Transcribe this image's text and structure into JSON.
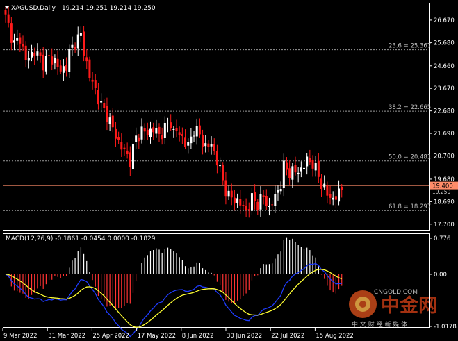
{
  "header": {
    "symbol": "XAGUSD,Daily",
    "ohlc": "19.214 19.251 19.214 19.250"
  },
  "macd_label": "MACD(12,26,9) -0.1861 -0.0454 0.0000 -0.1829",
  "price_ticks": [
    "26.670",
    "25.680",
    "24.660",
    "23.670",
    "22.680",
    "21.690",
    "20.700",
    "19.680",
    "18.690",
    "17.700"
  ],
  "price_axis_values": [
    26.67,
    25.68,
    24.66,
    23.67,
    22.68,
    21.69,
    20.7,
    19.68,
    18.69,
    17.7
  ],
  "price_range": [
    17.45,
    27.4
  ],
  "current_price": "19.400",
  "current_price_value": 19.4,
  "bid_label": "19.250",
  "fib_levels": [
    {
      "label": "23.6 = 25.367",
      "value": 25.367
    },
    {
      "label": "38.2 = 22.665",
      "value": 22.665
    },
    {
      "label": "50.0 = 20.481",
      "value": 20.481
    },
    {
      "label": "61.8 = 18.297",
      "value": 18.297
    }
  ],
  "macd_ticks": [
    "0.776",
    "0.00",
    "-1.0178"
  ],
  "macd_axis_values": [
    0.776,
    0.0,
    -1.0178
  ],
  "date_labels": [
    "9 Mar 2022",
    "31 Mar 2022",
    "25 Apr 2022",
    "17 May 2022",
    "8 Jun 2022",
    "30 Jun 2022",
    "22 Jul 2022",
    "15 Aug 2022"
  ],
  "watermark": {
    "cn_big": "中金网",
    "cn_small": "中 文 财 经 新 媒 体",
    "en": "CNGOLD.COM"
  },
  "colors": {
    "bull": "#ffffff",
    "bear": "#ff1a1a",
    "hist_pos": "#ffffff",
    "hist_neg": "#ff3333",
    "macd": "#1f3cff",
    "signal": "#ffff33",
    "current": "#ff8c69",
    "fib": "#9a9a9a"
  },
  "chart_data": {
    "type": "candlestick",
    "symbol": "XAGUSD",
    "timeframe": "Daily",
    "x_labels": [
      "9 Mar 2022",
      "31 Mar 2022",
      "25 Apr 2022",
      "17 May 2022",
      "8 Jun 2022",
      "30 Jun 2022",
      "22 Jul 2022",
      "15 Aug 2022"
    ],
    "ylim": [
      17.45,
      27.4
    ],
    "price_path": [
      [
        0,
        26.8
      ],
      [
        3,
        25.6
      ],
      [
        5,
        25.9
      ],
      [
        7,
        24.9
      ],
      [
        10,
        25.3
      ],
      [
        13,
        24.8
      ],
      [
        15,
        25.0
      ],
      [
        17,
        24.9
      ],
      [
        19,
        24.4
      ],
      [
        21,
        24.7
      ],
      [
        22,
        25.2
      ],
      [
        24,
        25.7
      ],
      [
        26,
        26.0
      ],
      [
        27,
        25.3
      ],
      [
        29,
        24.2
      ],
      [
        31,
        23.6
      ],
      [
        33,
        22.9
      ],
      [
        35,
        22.5
      ],
      [
        37,
        21.9
      ],
      [
        39,
        21.3
      ],
      [
        41,
        20.9
      ],
      [
        43,
        20.5
      ],
      [
        45,
        21.5
      ],
      [
        47,
        21.8
      ],
      [
        49,
        21.7
      ],
      [
        51,
        21.9
      ],
      [
        53,
        21.6
      ],
      [
        55,
        21.9
      ],
      [
        57,
        22.2
      ],
      [
        58,
        21.7
      ],
      [
        59,
        21.8
      ],
      [
        61,
        21.5
      ],
      [
        63,
        21.1
      ],
      [
        65,
        21.9
      ],
      [
        67,
        21.6
      ],
      [
        69,
        21.1
      ],
      [
        71,
        21.2
      ],
      [
        73,
        20.5
      ],
      [
        75,
        19.6
      ],
      [
        77,
        18.9
      ],
      [
        79,
        18.8
      ],
      [
        81,
        18.6
      ],
      [
        83,
        18.3
      ],
      [
        85,
        18.8
      ],
      [
        87,
        18.6
      ],
      [
        89,
        18.9
      ],
      [
        91,
        18.4
      ],
      [
        93,
        18.9
      ],
      [
        95,
        19.5
      ],
      [
        96,
        20.2
      ],
      [
        98,
        20.0
      ],
      [
        100,
        20.0
      ],
      [
        102,
        20.1
      ],
      [
        104,
        20.5
      ],
      [
        106,
        20.4
      ],
      [
        107,
        20.1
      ],
      [
        109,
        19.5
      ],
      [
        111,
        19.0
      ],
      [
        113,
        18.8
      ],
      [
        115,
        19.05
      ],
      [
        116,
        19.25
      ]
    ],
    "series": [
      {
        "name": "MACD(12,26,9)",
        "last": -0.1861
      },
      {
        "name": "Signal",
        "last": -0.0454
      },
      {
        "name": "Histogram",
        "last": -0.1829
      }
    ],
    "macd_range": [
      -1.0178,
      0.776
    ],
    "fib_retracements": [
      {
        "level": "23.6",
        "value": 25.367
      },
      {
        "level": "38.2",
        "value": 22.665
      },
      {
        "level": "50.0",
        "value": 20.481
      },
      {
        "level": "61.8",
        "value": 18.297
      }
    ],
    "current_price": 19.4,
    "bid": 19.25
  }
}
